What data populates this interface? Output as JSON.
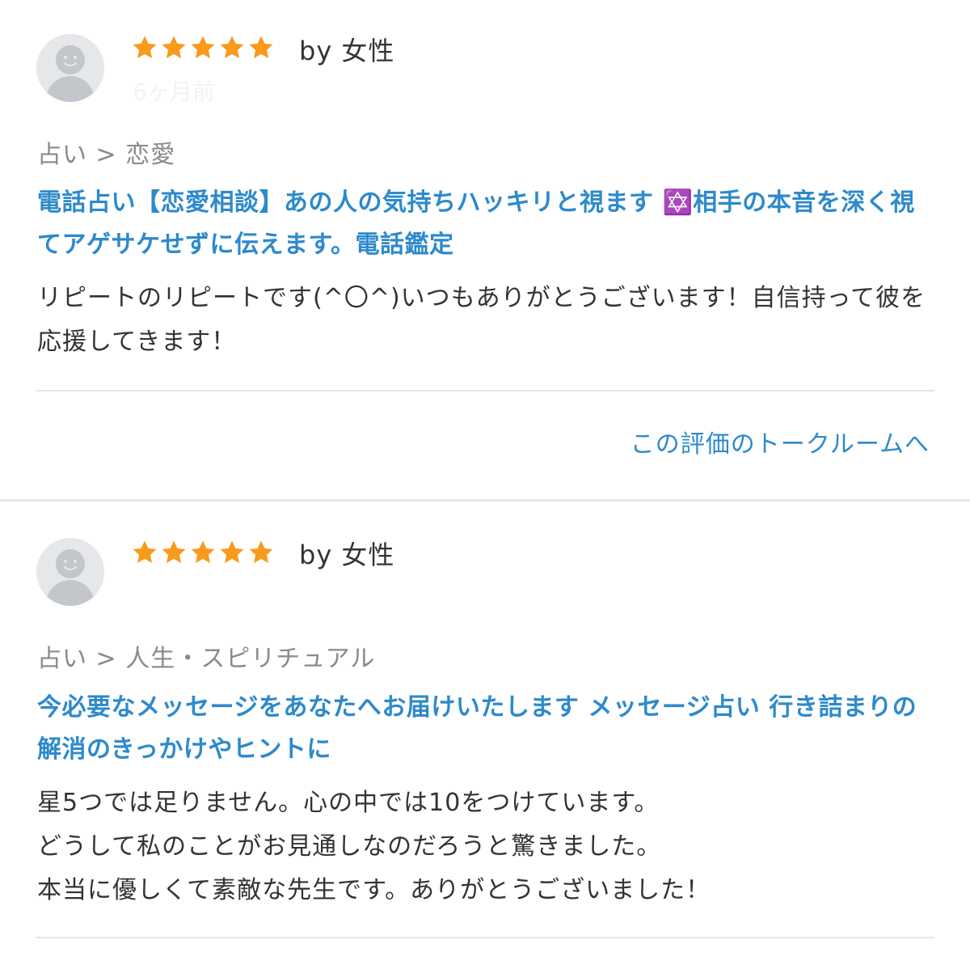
{
  "colors": {
    "star": "#f89a1c",
    "link": "#2d8acb",
    "text": "#333333",
    "muted": "#8a8a8a",
    "divider": "#e3e5e8",
    "avatar_bg": "#e6e7e9",
    "avatar_fg": "#c3c6cb"
  },
  "reviews": [
    {
      "rating": 5,
      "reviewer": "by 女性",
      "date": "6ヶ月前",
      "category": "占い > 恋愛",
      "service_title": "電話占い【恋愛相談】あの人の気持ちハッキリと視ます ✡️相手の本音を深く視てアゲサケせずに伝えます。電話鑑定",
      "comment": "リピートのリピートです(^〇^)いつもありがとうございます！自信持って彼を応援してきます！",
      "talkroom_link": "この評価のトークルームへ"
    },
    {
      "rating": 5,
      "reviewer": "by 女性",
      "date": "",
      "category": "占い > 人生・スピリチュアル",
      "service_title": "今必要なメッセージをあなたへお届けいたします メッセージ占い 行き詰まりの解消のきっかけやヒントに",
      "comment": "星5つでは足りません。心の中では10をつけています。\nどうして私のことがお見通しなのだろうと驚きました。\n本当に優しくて素敵な先生です。ありがとうございました！"
    }
  ]
}
